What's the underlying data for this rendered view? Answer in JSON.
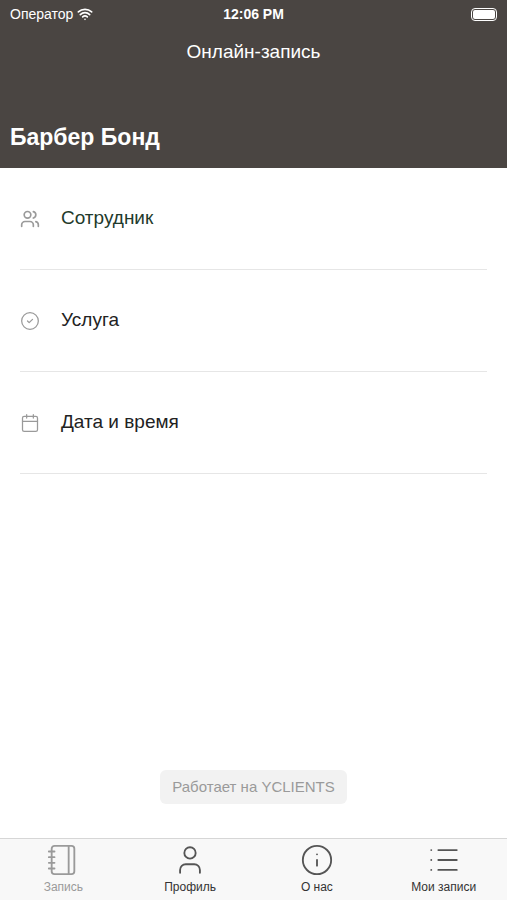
{
  "status_bar": {
    "carrier": "Оператор",
    "time": "12:06 PM"
  },
  "header": {
    "title": "Онлайн-запись",
    "salon": "Барбер Бонд"
  },
  "steps": [
    {
      "label": "Сотрудник",
      "kind": "staff",
      "selected": true
    },
    {
      "label": "Услуга",
      "kind": "service",
      "selected": false
    },
    {
      "label": "Дата и время",
      "kind": "datetime",
      "selected": false
    }
  ],
  "footer": {
    "badge": "Работает на YCLIENTS"
  },
  "tabs": [
    {
      "label": "Запись",
      "kind": "booking",
      "selected": true
    },
    {
      "label": "Профиль",
      "kind": "profile",
      "selected": false
    },
    {
      "label": "О нас",
      "kind": "about",
      "selected": false
    },
    {
      "label": "Мои записи",
      "kind": "records",
      "selected": false
    }
  ]
}
